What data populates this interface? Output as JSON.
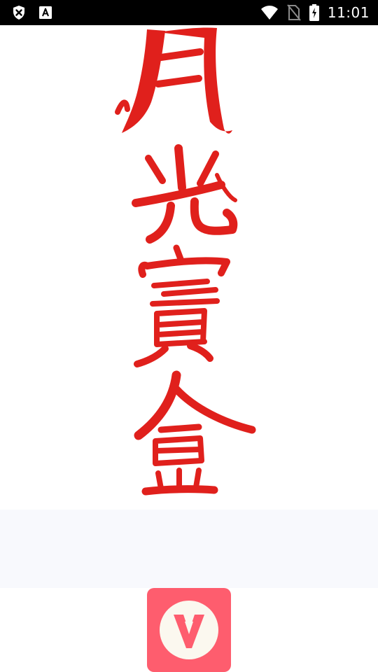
{
  "status_bar": {
    "time": "11:01",
    "left_icons": [
      "shield-x-icon",
      "text-a-icon"
    ],
    "right_icons": [
      "wifi-icon",
      "no-sim-icon",
      "battery-charging-icon"
    ]
  },
  "splash": {
    "calligraphy_text": "月光寶盒",
    "calligraphy_color": "#e0201c"
  },
  "app_logo": {
    "icon": "v-logo-icon",
    "background_color": "#fe5d6e",
    "circle_color": "#fbf8ef"
  }
}
